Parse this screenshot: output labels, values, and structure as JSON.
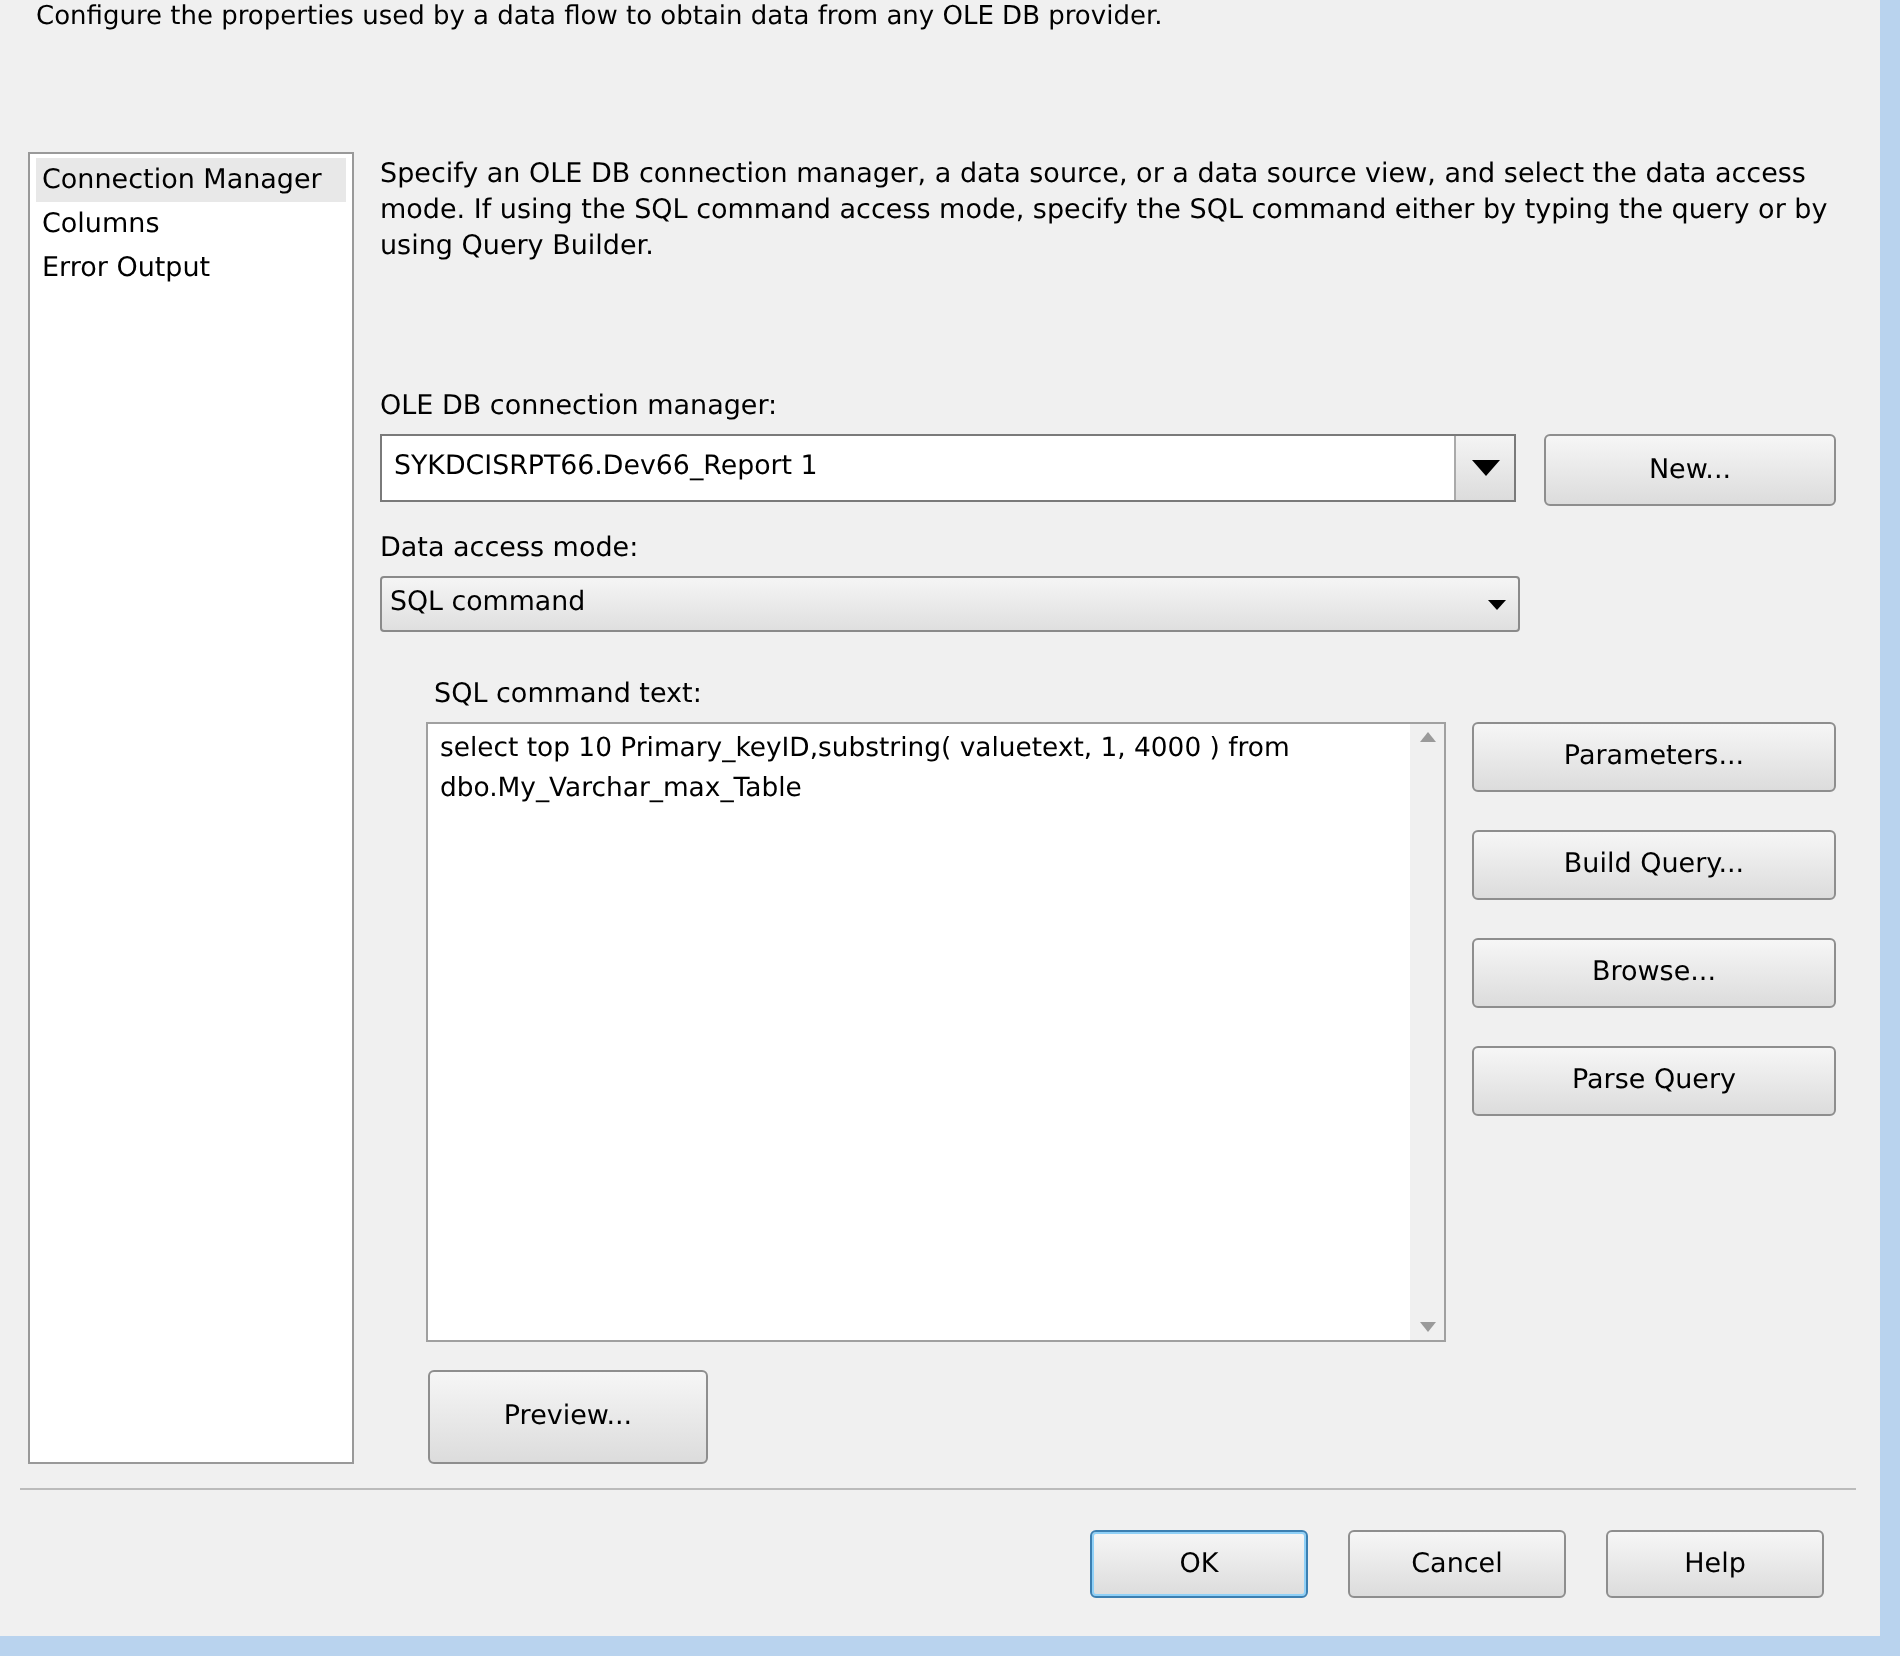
{
  "header": {
    "description": "Configure the properties used by a data flow to obtain data from any OLE DB provider."
  },
  "sidebar": {
    "items": [
      {
        "label": "Connection Manager",
        "selected": true
      },
      {
        "label": "Columns",
        "selected": false
      },
      {
        "label": "Error Output",
        "selected": false
      }
    ]
  },
  "instructions": "Specify an OLE DB connection manager, a data source, or a data source view, and select the data access mode. If using the SQL command access mode, specify the SQL command either by typing the query or by using Query Builder.",
  "connection": {
    "label": "OLE DB connection manager:",
    "value": "SYKDCISRPT66.Dev66_Report 1",
    "button": "New..."
  },
  "access_mode": {
    "label": "Data access mode:",
    "value": "SQL command"
  },
  "sql": {
    "label": "SQL command text:",
    "value": "select top 10 Primary_keyID,substring( valuetext, 1, 4000 ) from dbo.My_Varchar_max_Table",
    "buttons": [
      "Parameters...",
      "Build Query...",
      "Browse...",
      "Parse Query"
    ]
  },
  "preview_button": "Preview...",
  "footer_buttons": [
    {
      "label": "OK",
      "default": true
    },
    {
      "label": "Cancel",
      "default": false
    },
    {
      "label": "Help",
      "default": false
    }
  ]
}
